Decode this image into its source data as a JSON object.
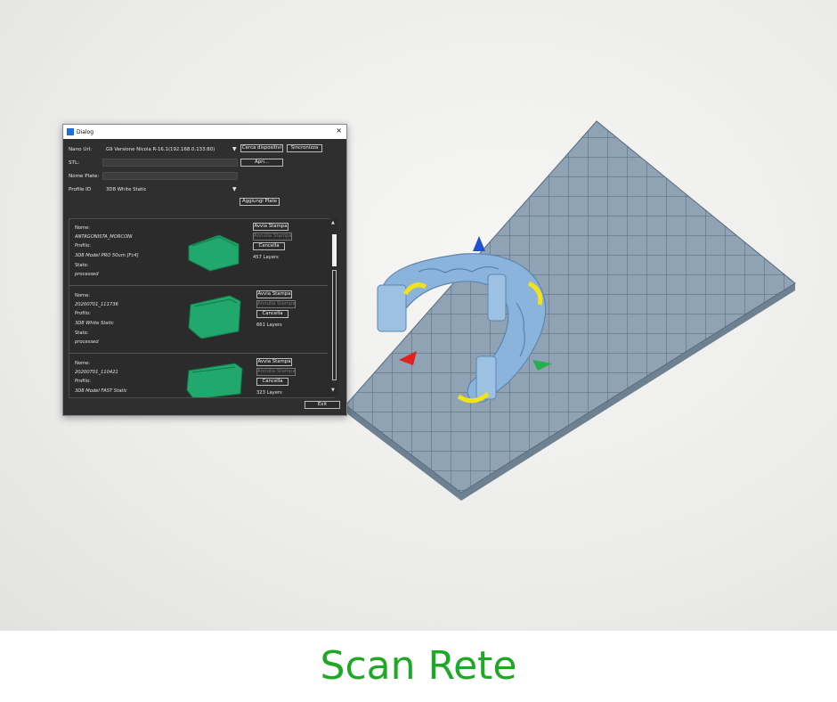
{
  "dialog": {
    "title": "Dialog",
    "close_glyph": "×",
    "nano_url_label": "Nano Url:",
    "nano_url_value": "G9 Versione Nicola R-16.1(192.168.0.133:80)",
    "cerca_label": "Cerca dispositivi",
    "sincronizza_label": "Sincronizza",
    "stl_label": "STL:",
    "stl_value": "",
    "apri_label": "Apri...",
    "nome_plate_label": "Nome Plate:",
    "nome_plate_value": "",
    "profile_id_label": "Profile ID",
    "profile_id_value": "3D8 White Static",
    "aggiungi_label": "Aggiungi Plate",
    "exit_label": "Exit",
    "scroll_up": "▲",
    "scroll_down": "▼",
    "dropdown_arrow": "▼",
    "jobs": [
      {
        "nome_label": "Nome:",
        "nome": "ANTAGONISTA_MORCONI",
        "profilo_label": "Profilo:",
        "profilo": "3D8 Model PRO 50um [Fc4]",
        "stato_label": "Stato:",
        "stato": "processed",
        "avvia_label": "Avvia Stampa",
        "annulla_label": "Annulla Stampa",
        "cancella_label": "Cancella",
        "layers": "457 Layers"
      },
      {
        "nome_label": "Nome:",
        "nome": "20200701_111736",
        "profilo_label": "Profilo:",
        "profilo": "3D8 White Static",
        "stato_label": "Stato:",
        "stato": "processed",
        "avvia_label": "Avvia Stampa",
        "annulla_label": "Annulla Stampa",
        "cancella_label": "Cancella",
        "layers": "661 Layers"
      },
      {
        "nome_label": "Nome:",
        "nome": "20200701_110421",
        "profilo_label": "Profilo:",
        "profilo": "3D8 Model FAST Static",
        "stato_label": "",
        "stato": "",
        "avvia_label": "Avvia Stampa",
        "annulla_label": "Annulla Stampa",
        "cancella_label": "Cancella",
        "layers": "323 Layers"
      }
    ]
  },
  "caption": "Scan Rete",
  "colors": {
    "caption": "#1ea826",
    "plate": "#8fa3b5",
    "model": "#8ab4dc",
    "thumb_model": "#21a86c",
    "gizmo_x": "#e0211c",
    "gizmo_y": "#22b14c",
    "gizmo_z": "#1f4fd6",
    "rotate_handle": "#f2e21a"
  }
}
